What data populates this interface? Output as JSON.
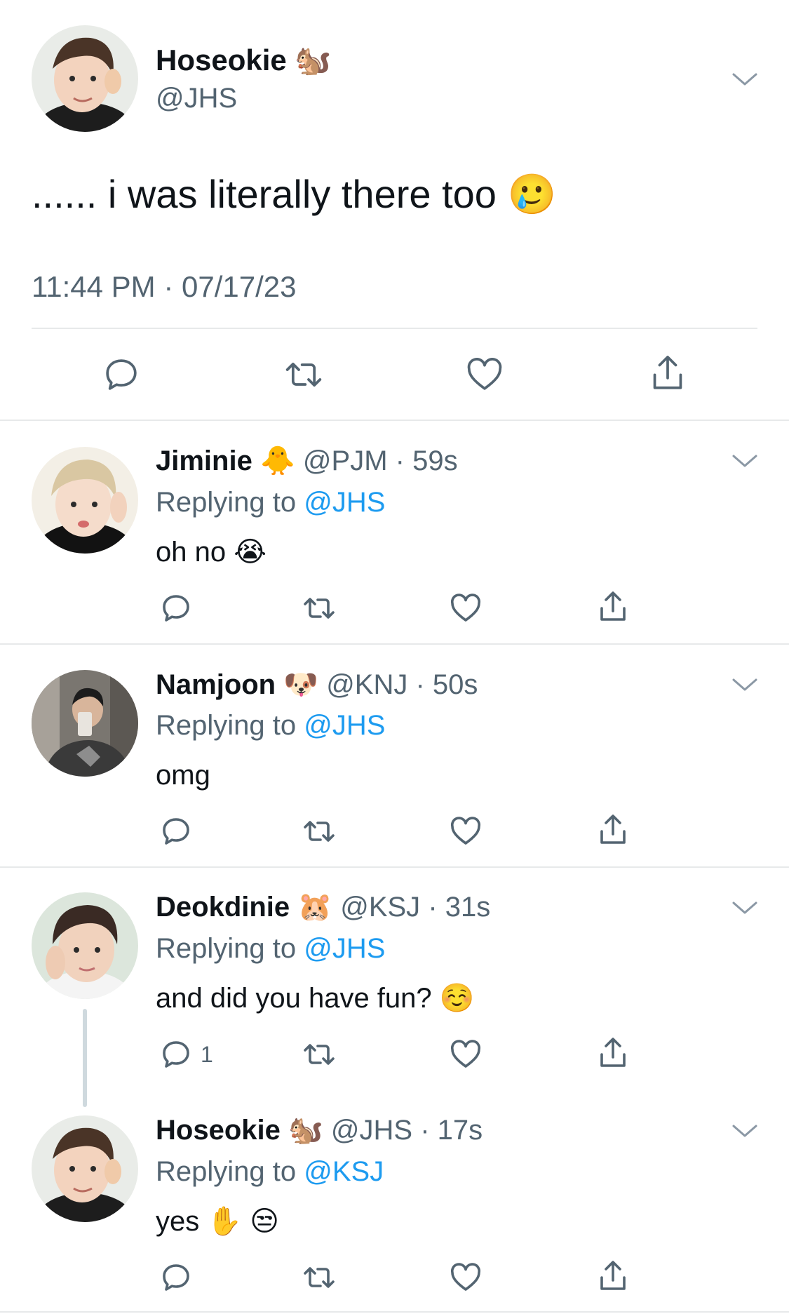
{
  "main_tweet": {
    "display_name": "Hoseokie",
    "name_emoji": "🐿️",
    "handle": "@JHS",
    "text": "...... i was literally there too",
    "text_emoji": "🥲",
    "timestamp": "11:44 PM · 07/17/23"
  },
  "replies": [
    {
      "display_name": "Jiminie",
      "name_emoji": "🐥",
      "handle": "@PJM",
      "time": "· 59s",
      "replying_prefix": "Replying to",
      "replying_to": "@JHS",
      "text": "oh no",
      "text_emoji": "😭",
      "reply_count": ""
    },
    {
      "display_name": "Namjoon",
      "name_emoji": "🐶",
      "handle": "@KNJ",
      "time": "· 50s",
      "replying_prefix": "Replying to",
      "replying_to": "@JHS",
      "text": "omg",
      "text_emoji": "",
      "reply_count": ""
    },
    {
      "display_name": "Deokdinie",
      "name_emoji": "🐹",
      "handle": "@KSJ",
      "time": "· 31s",
      "replying_prefix": "Replying to",
      "replying_to": "@JHS",
      "text": "and did you have fun?",
      "text_emoji": "☺️",
      "reply_count": "1"
    },
    {
      "display_name": "Hoseokie",
      "name_emoji": "🐿️",
      "handle": "@JHS",
      "time": "· 17s",
      "replying_prefix": "Replying to",
      "replying_to": "@KSJ",
      "text": "yes",
      "text_emoji": "✋ 😒",
      "reply_count": ""
    }
  ],
  "colors": {
    "text": "#0f1419",
    "muted": "#536471",
    "link": "#1d9bf0",
    "divider": "#e7e9ea"
  },
  "icons": [
    "reply-icon",
    "retweet-icon",
    "like-icon",
    "share-icon",
    "chevron-down-icon"
  ]
}
